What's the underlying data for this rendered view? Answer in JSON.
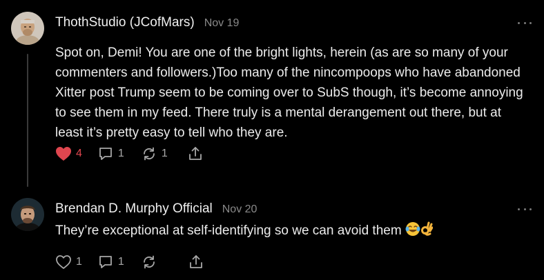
{
  "colors": {
    "background": "#000000",
    "text": "#ececec",
    "muted": "#8a8a8a",
    "like_active": "#e0464f"
  },
  "comments": [
    {
      "author": "ThothStudio (JCofMars)",
      "date": "Nov 19",
      "text": "Spot on, Demi! You are one of the bright lights, herein (as are so many of your commenters and followers.)Too many of the nincompoops who have abandoned Xitter post Trump seem to be coming over to SubS though, it’s become annoying to see them in my feed. There truly is a mental derangement out there, but at least it’s pretty easy to tell who they are.",
      "likes": "4",
      "liked": true,
      "replies": "1",
      "restacks": "1",
      "icons": [
        "heart-icon",
        "comment-icon",
        "restack-icon",
        "share-icon",
        "more-icon"
      ]
    },
    {
      "author": "Brendan D. Murphy Official",
      "date": "Nov 20",
      "text": "They’re exceptional at self-identifying so we can avoid them",
      "emojis": [
        "face-with-tears-of-joy-emoji",
        "ok-hand-emoji"
      ],
      "likes": "1",
      "liked": false,
      "replies": "1",
      "restacks": "",
      "icons": [
        "heart-icon",
        "comment-icon",
        "restack-icon",
        "share-icon",
        "more-icon"
      ]
    }
  ]
}
